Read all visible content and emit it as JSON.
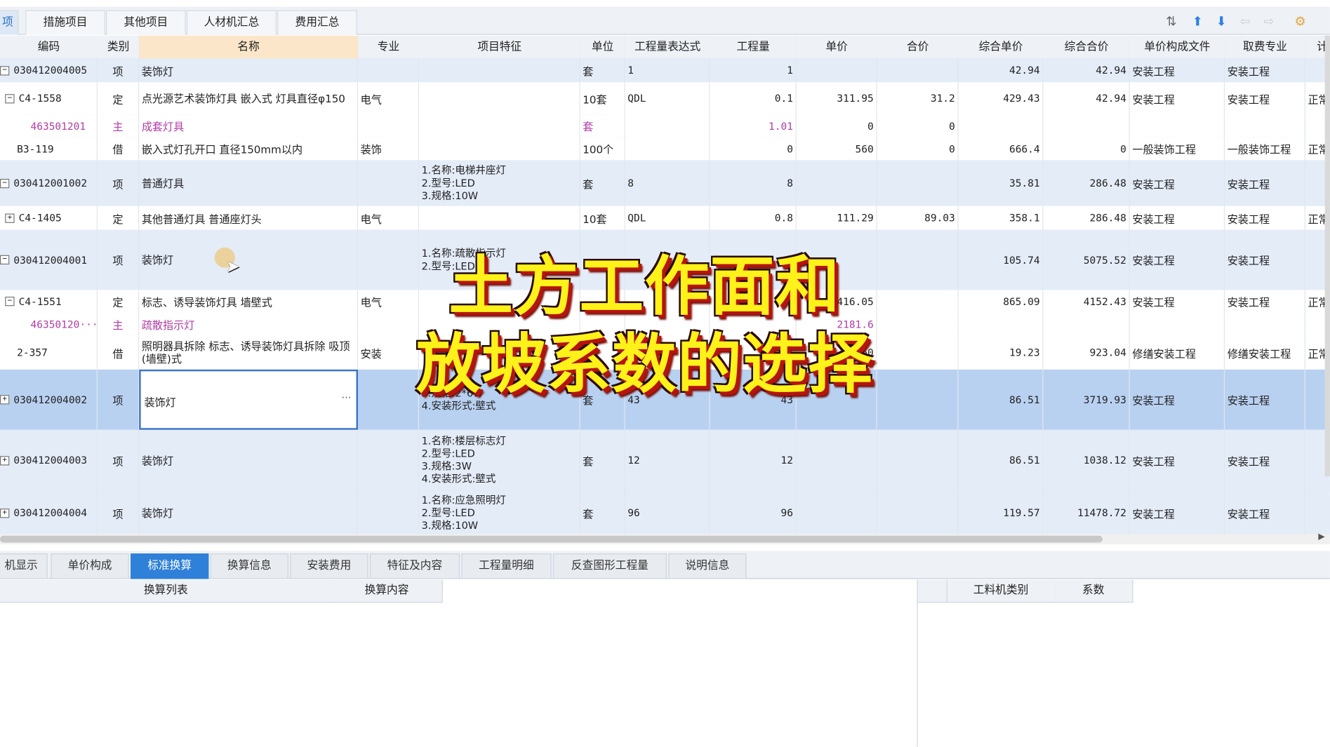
{
  "top_tabs": [
    {
      "label": "项"
    },
    {
      "label": "措施项目"
    },
    {
      "label": "其他项目"
    },
    {
      "label": "人材机汇总"
    },
    {
      "label": "费用汇总"
    }
  ],
  "toolbar_icons": [
    "sort-icon",
    "arrow-up-icon",
    "arrow-down-icon",
    "arrow-left-icon",
    "arrow-right-icon",
    "settings-icon"
  ],
  "columns": [
    "编码",
    "类别",
    "名称",
    "专业",
    "项目特征",
    "单位",
    "工程量表达式",
    "工程量",
    "单价",
    "合价",
    "综合单价",
    "综合合价",
    "单价构成文件",
    "取费专业",
    "计"
  ],
  "rows": [
    {
      "kind": "qd",
      "toggle": "−",
      "code": "030412004005",
      "type": "项",
      "name": "装饰灯",
      "major": "",
      "feature": "",
      "unit": "套",
      "expr": "1",
      "qty": "1",
      "price": "",
      "total": "",
      "cprice": "42.94",
      "ctotal": "42.94",
      "file": "安装工程",
      "fee": "安装工程",
      "extra": ""
    },
    {
      "kind": "sub",
      "toggle": "−",
      "code": "C4-1558",
      "type": "定",
      "name": "点光源艺术装饰灯具 嵌入式 灯具直径φ150",
      "major": "电气",
      "feature": "",
      "unit": "10套",
      "expr": "QDL",
      "qty": "0.1",
      "price": "311.95",
      "total": "31.2",
      "cprice": "429.43",
      "ctotal": "42.94",
      "file": "安装工程",
      "fee": "安装工程",
      "extra": "正常"
    },
    {
      "kind": "mat",
      "toggle": "",
      "code": "463501201",
      "type": "主",
      "name": "成套灯具",
      "major": "",
      "feature": "",
      "unit": "套",
      "expr": "",
      "qty": "1.01",
      "price": "0",
      "total": "0",
      "cprice": "",
      "ctotal": "",
      "file": "",
      "fee": "",
      "extra": ""
    },
    {
      "kind": "sub",
      "toggle": "",
      "code": "B3-119",
      "type": "借",
      "name": "嵌入式灯孔开口 直径150mm以内",
      "major": "装饰",
      "feature": "",
      "unit": "100个",
      "expr": "",
      "qty": "0",
      "price": "560",
      "total": "0",
      "cprice": "666.4",
      "ctotal": "0",
      "file": "一般装饰工程",
      "fee": "一般装饰工程",
      "extra": "正常"
    },
    {
      "kind": "qd",
      "toggle": "−",
      "code": "030412001002",
      "type": "项",
      "name": "普通灯具",
      "major": "",
      "feature": "1.名称:电梯井座灯\n2.型号:LED\n3.规格:10W",
      "unit": "套",
      "expr": "8",
      "qty": "8",
      "price": "",
      "total": "",
      "cprice": "35.81",
      "ctotal": "286.48",
      "file": "安装工程",
      "fee": "安装工程",
      "extra": ""
    },
    {
      "kind": "sub",
      "toggle": "+",
      "code": "C4-1405",
      "type": "定",
      "name": "其他普通灯具 普通座灯头",
      "major": "电气",
      "feature": "",
      "unit": "10套",
      "expr": "QDL",
      "qty": "0.8",
      "price": "111.29",
      "total": "89.03",
      "cprice": "358.1",
      "ctotal": "286.48",
      "file": "安装工程",
      "fee": "安装工程",
      "extra": "正常"
    },
    {
      "kind": "qd",
      "toggle": "−",
      "code": "030412004001",
      "type": "项",
      "name": "装饰灯",
      "major": "",
      "feature": "1.名称:疏散指示灯\n2.型号:LED",
      "unit": "",
      "expr": "",
      "qty": "",
      "price": "",
      "total": "",
      "cprice": "105.74",
      "ctotal": "5075.52",
      "file": "安装工程",
      "fee": "安装工程",
      "extra": ""
    },
    {
      "kind": "sub",
      "toggle": "−",
      "code": "C4-1551",
      "type": "定",
      "name": "标志、诱导装饰灯具 墙壁式",
      "major": "电气",
      "feature": "",
      "unit": "",
      "expr": "",
      "qty": "01",
      "price": "1416.05",
      "total": "",
      "cprice": "865.09",
      "ctotal": "4152.43",
      "file": "安装工程",
      "fee": "安装工程",
      "extra": "正常"
    },
    {
      "kind": "mat",
      "toggle": "",
      "code": "46350120···",
      "type": "主",
      "name": "疏散指示灯",
      "major": "",
      "feature": "",
      "unit": "",
      "expr": "",
      "qty": "",
      "price": "2181.6",
      "total": "",
      "cprice": "",
      "ctotal": "",
      "file": "",
      "fee": "",
      "extra": ""
    },
    {
      "kind": "sub",
      "toggle": "",
      "code": "2-357",
      "type": "借",
      "name": "照明器具拆除 标志、诱导装饰灯具拆除 吸顶(墙壁)式",
      "major": "安装",
      "feature": "",
      "unit": "",
      "expr": "",
      "qty": "",
      "price": "660",
      "total": "",
      "cprice": "19.23",
      "ctotal": "923.04",
      "file": "修缮安装工程",
      "fee": "修缮安装工程",
      "extra": "正常"
    },
    {
      "kind": "current",
      "toggle": "+",
      "code": "030412004002",
      "type": "项",
      "name": "装饰灯",
      "major": "",
      "feature": "3.规格:2*6W\n4.安装形式:壁式",
      "unit": "套",
      "expr": "43",
      "qty": "43",
      "price": "",
      "total": "",
      "cprice": "86.51",
      "ctotal": "3719.93",
      "file": "安装工程",
      "fee": "安装工程",
      "extra": ""
    },
    {
      "kind": "qd",
      "toggle": "+",
      "code": "030412004003",
      "type": "项",
      "name": "装饰灯",
      "major": "",
      "feature": "1.名称:楼层标志灯\n2.型号:LED\n3.规格:3W\n4.安装形式:壁式",
      "unit": "套",
      "expr": "12",
      "qty": "12",
      "price": "",
      "total": "",
      "cprice": "86.51",
      "ctotal": "1038.12",
      "file": "安装工程",
      "fee": "安装工程",
      "extra": ""
    },
    {
      "kind": "qd",
      "toggle": "+",
      "code": "030412004004",
      "type": "项",
      "name": "装饰灯",
      "major": "",
      "feature": "1.名称:应急照明灯\n2.型号:LED\n3.规格:10W",
      "unit": "套",
      "expr": "96",
      "qty": "96",
      "price": "",
      "total": "",
      "cprice": "119.57",
      "ctotal": "11478.72",
      "file": "安装工程",
      "fee": "安装工程",
      "extra": ""
    }
  ],
  "name_cell_more": "···",
  "bottom_tabs": [
    {
      "label": "机显示"
    },
    {
      "label": "单价构成"
    },
    {
      "label": "标准换算"
    },
    {
      "label": "换算信息"
    },
    {
      "label": "安装费用"
    },
    {
      "label": "特征及内容"
    },
    {
      "label": "工程量明细"
    },
    {
      "label": "反查图形工程量"
    },
    {
      "label": "说明信息"
    }
  ],
  "lower_left_headers": [
    "换算列表",
    "换算内容"
  ],
  "lower_right_headers": [
    "工料机类别",
    "系数"
  ],
  "overlay_title": {
    "line1": "土方工作面和",
    "line2": "放坡系数的选择"
  },
  "colors": {
    "accent": "#2f80d8",
    "selected_row": "#b9d1f1",
    "qd_row": "#e4ecf8",
    "material_text": "#b13ba6",
    "overlay_text": "#fff21a",
    "overlay_outline": "#b5140c"
  }
}
